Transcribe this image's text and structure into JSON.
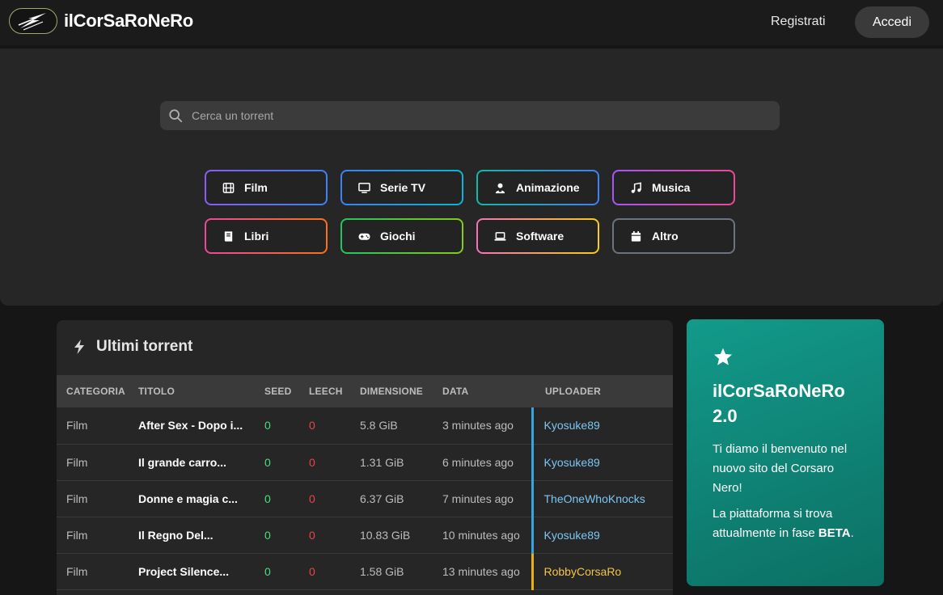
{
  "header": {
    "logo_text": "ilCorSaRoNeRo",
    "register_label": "Registrati",
    "login_label": "Accedi"
  },
  "search": {
    "placeholder": "Cerca un torrent"
  },
  "categories": [
    {
      "label": "Film",
      "icon": "film-icon",
      "colors": [
        "#8b5cf6",
        "#3b82f6"
      ]
    },
    {
      "label": "Serie TV",
      "icon": "tv-icon",
      "colors": [
        "#3b82f6",
        "#06b6d4"
      ]
    },
    {
      "label": "Animazione",
      "icon": "character-icon",
      "colors": [
        "#14b8a6",
        "#3b82f6"
      ]
    },
    {
      "label": "Musica",
      "icon": "music-note-icon",
      "colors": [
        "#a855f7",
        "#ec4899"
      ]
    },
    {
      "label": "Libri",
      "icon": "book-icon",
      "colors": [
        "#ec4899",
        "#f97316"
      ]
    },
    {
      "label": "Giochi",
      "icon": "gamepad-icon",
      "colors": [
        "#22c55e",
        "#84cc16"
      ]
    },
    {
      "label": "Software",
      "icon": "laptop-icon",
      "colors": [
        "#f472b6",
        "#facc15"
      ]
    },
    {
      "label": "Altro",
      "icon": "calendar-icon",
      "colors": [
        "#6b7280",
        "#6b7280"
      ]
    }
  ],
  "latest": {
    "title": "Ultimi torrent",
    "columns": [
      "CATEGORIA",
      "TITOLO",
      "SEED",
      "LEECH",
      "DIMENSIONE",
      "DATA",
      "UPLOADER"
    ],
    "rows": [
      {
        "category": "Film",
        "title": "After Sex - Dopo i...",
        "seed": "0",
        "leech": "0",
        "size": "5.8 GiB",
        "date": "3 minutes ago",
        "uploader": "Kyosuke89",
        "uploader_color": "blue"
      },
      {
        "category": "Film",
        "title": "Il grande carro...",
        "seed": "0",
        "leech": "0",
        "size": "1.31 GiB",
        "date": "6 minutes ago",
        "uploader": "Kyosuke89",
        "uploader_color": "blue"
      },
      {
        "category": "Film",
        "title": "Donne e magia c...",
        "seed": "0",
        "leech": "0",
        "size": "6.37 GiB",
        "date": "7 minutes ago",
        "uploader": "TheOneWhoKnocks",
        "uploader_color": "blue"
      },
      {
        "category": "Film",
        "title": "Il Regno Del...",
        "seed": "0",
        "leech": "0",
        "size": "10.83 GiB",
        "date": "10 minutes ago",
        "uploader": "Kyosuke89",
        "uploader_color": "blue"
      },
      {
        "category": "Film",
        "title": "Project Silence...",
        "seed": "0",
        "leech": "0",
        "size": "1.58 GiB",
        "date": "13 minutes ago",
        "uploader": "RobbyCorsaRo",
        "uploader_color": "gold"
      }
    ]
  },
  "promo": {
    "title": "ilCorSaRoNeRo 2.0",
    "p1": "Ti diamo il benvenuto nel nuovo sito del Corsaro Nero!",
    "p2_prefix": "La piattaforma si trova attualmente in fase ",
    "p2_bold": "BETA",
    "p2_suffix": "."
  }
}
